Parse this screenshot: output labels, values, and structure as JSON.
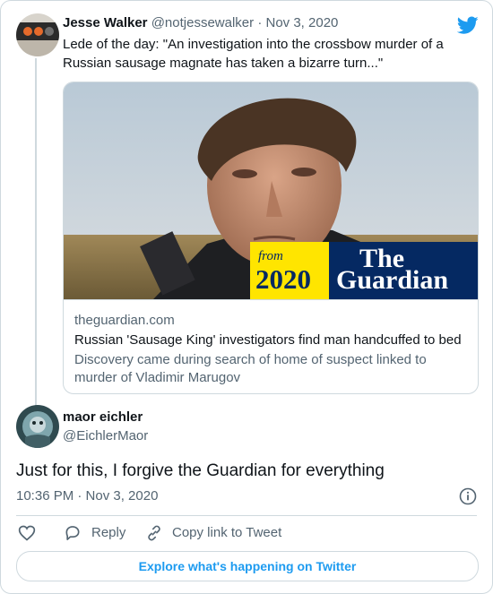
{
  "tweet": {
    "author_name": "Jesse Walker",
    "author_handle": "@notjessewalker",
    "separator": "·",
    "date": "Nov 3, 2020",
    "text": "Lede of the day: \"An investigation into the crossbow murder of a Russian sausage magnate has taken a bizarre turn...\"",
    "link_card": {
      "domain": "theguardian.com",
      "title": "Russian 'Sausage King' investigators find man handcuffed to bed",
      "description": "Discovery came during search of home of suspect linked to murder of Vladimir Marugov",
      "badge_from": "from",
      "badge_year": "2020",
      "badge_logo_line1": "The",
      "badge_logo_line2": "Guardian"
    }
  },
  "reply": {
    "author_name": "maor eichler",
    "author_handle": "@EichlerMaor",
    "text": "Just for this, I forgive the Guardian for everything",
    "timestamp": "10:36 PM · Nov 3, 2020"
  },
  "actions": {
    "reply_label": "Reply",
    "copy_link_label": "Copy link to Tweet"
  },
  "footer": {
    "explore_label": "Explore what's happening on Twitter"
  },
  "colors": {
    "twitter_blue": "#1d9bf0",
    "guardian_navy": "#052962",
    "guardian_yellow": "#ffe500"
  },
  "icons": [
    "twitter-bird-icon",
    "info-icon",
    "heart-icon",
    "reply-icon",
    "link-icon"
  ]
}
